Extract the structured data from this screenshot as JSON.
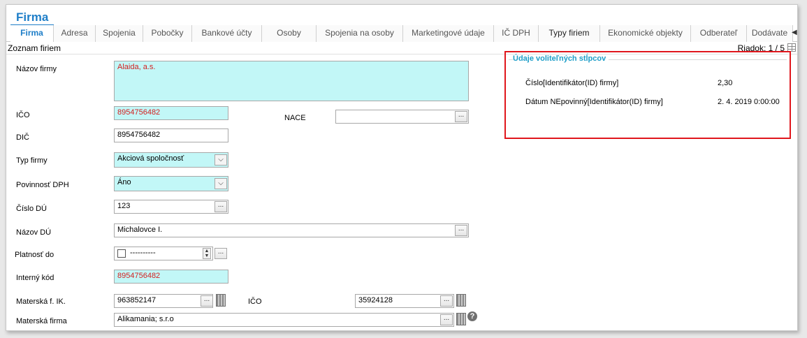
{
  "window": {
    "title": "Firma"
  },
  "tabs": [
    {
      "label": "Firma"
    },
    {
      "label": "Adresa"
    },
    {
      "label": "Spojenia"
    },
    {
      "label": "Pobočky"
    },
    {
      "label": "Bankové účty"
    },
    {
      "label": "Osoby"
    },
    {
      "label": "Spojenia na osoby"
    },
    {
      "label": "Marketingové údaje"
    },
    {
      "label": "IČ DPH"
    },
    {
      "label": "Typy firiem"
    },
    {
      "label": "Ekonomické objekty"
    },
    {
      "label": "Odberateľ"
    },
    {
      "label": "Dodávate"
    }
  ],
  "subheader": {
    "title": "Zoznam firiem",
    "row_counter": "Riadok: 1 / 5"
  },
  "form": {
    "nazov_firmy": {
      "label": "Názov firmy",
      "value": "Alaida, a.s."
    },
    "ico": {
      "label": "IČO",
      "value": "8954756482"
    },
    "nace": {
      "label": "NACE",
      "value": ""
    },
    "dic": {
      "label": "DIČ",
      "value": "8954756482"
    },
    "typ_firmy": {
      "label": "Typ firmy",
      "value": "Akciová spoločnosť"
    },
    "povinnost_dph": {
      "label": "Povinnosť DPH",
      "value": "Áno"
    },
    "cislo_du": {
      "label": "Číslo DÚ",
      "value": "123"
    },
    "nazov_du": {
      "label": "Názov DÚ",
      "value": "Michalovce I."
    },
    "platnost_do": {
      "label": "Platnosť do",
      "value": "----------"
    },
    "interny_kod": {
      "label": "Interný kód",
      "value": "8954756482"
    },
    "materska_ik": {
      "label": "Materská f. IK.",
      "value": "963852147"
    },
    "materska_ico": {
      "label": "IČO",
      "value": "35924128"
    },
    "materska_firma": {
      "label": "Materská firma",
      "value": "Alikamania; s.r.o"
    },
    "dots_label": "...",
    "help_glyph": "?"
  },
  "optional_columns": {
    "title": "Údaje voliteľných stĺpcov",
    "rows": [
      {
        "label": "Číslo[Identifikátor(ID) firmy]",
        "value": "2,30"
      },
      {
        "label": "Dátum NEpovinný[Identifikátor(ID) firmy]",
        "value": "2. 4. 2019 0:00:00"
      }
    ]
  },
  "colors": {
    "accent": "#1e7ec8",
    "required_bg": "#c2f7f7",
    "required_text": "#d42020",
    "highlight_border": "#e0161c"
  }
}
